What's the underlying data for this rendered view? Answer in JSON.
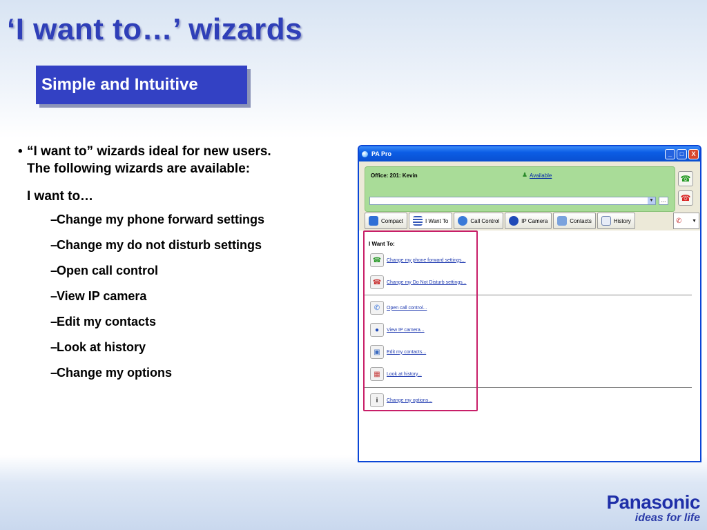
{
  "slide": {
    "title": "‘I want to…’ wizards",
    "subtitle": "Simple and Intuitive"
  },
  "bullets": {
    "main_line1": "“I want to” wizards ideal for new users.",
    "main_line2": "The following wizards are available:",
    "lead": "I want to…",
    "items": [
      "Change my phone forward settings",
      "Change my do not disturb settings",
      "Open call control",
      "View IP camera",
      "Edit my contacts",
      "Look at history",
      "Change my options"
    ]
  },
  "window": {
    "title": "PA Pro",
    "buttons": {
      "minimize": "_",
      "maximize": "□",
      "close": "X"
    },
    "status": {
      "office": "Office: 201: Kevin",
      "availability": "Available",
      "ellipsis": "..."
    },
    "tabs": [
      {
        "label": "Compact",
        "icon": "compact-icon"
      },
      {
        "label": "I Want To",
        "icon": "list-icon"
      },
      {
        "label": "Call Control",
        "icon": "phone-icon"
      },
      {
        "label": "IP Camera",
        "icon": "camera-icon"
      },
      {
        "label": "Contacts",
        "icon": "contacts-icon"
      },
      {
        "label": "History",
        "icon": "calendar-icon"
      }
    ],
    "wizard": {
      "heading": "I Want To:",
      "links": [
        "Change my phone forward settings...",
        "Change my Do Not Disturb settings...",
        "Open call control...",
        "View IP camera...",
        "Edit my contacts...",
        "Look at history...",
        "Change my options..."
      ]
    }
  },
  "brand": {
    "name": "Panasonic",
    "tagline": "ideas for life",
    "color": "#1f2fa8"
  }
}
